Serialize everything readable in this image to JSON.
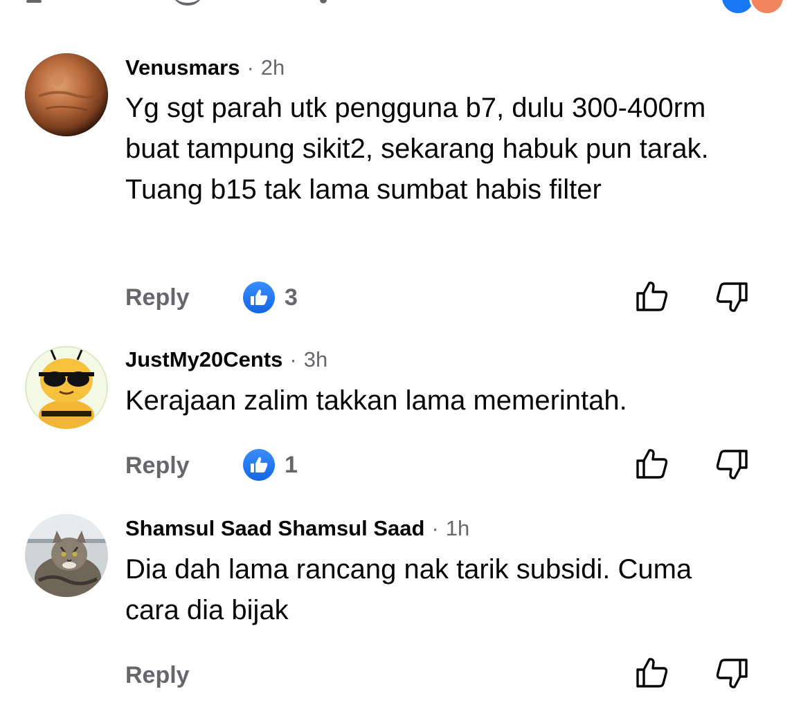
{
  "colors": {
    "primary_text": "#050505",
    "secondary_text": "#65676b",
    "like_blue": "#1877f2",
    "background": "#ffffff"
  },
  "icons": {
    "like_badge": "thumbs-up-icon",
    "upvote": "thumbs-up-outline-icon",
    "downvote": "thumbs-down-outline-icon"
  },
  "comments": [
    {
      "author": "Venusmars",
      "separator": "·",
      "time": "2h",
      "text": "Yg sgt parah utk pengguna b7, dulu 300-400rm buat tampung sikit2, sekarang habuk pun tarak. Tuang b15 tak lama sumbat habis filter",
      "reply_label": "Reply",
      "like_count": "3",
      "avatar": "mars-planet"
    },
    {
      "author": "JustMy20Cents",
      "separator": "·",
      "time": "3h",
      "text": "Kerajaan zalim takkan lama memerintah.",
      "reply_label": "Reply",
      "like_count": "1",
      "avatar": "bee-with-sunglasses"
    },
    {
      "author": "Shamsul Saad Shamsul Saad",
      "separator": "·",
      "time": "1h",
      "text": "Dia dah lama rancang nak tarik subsidi. Cuma cara dia bijak",
      "reply_label": "Reply",
      "avatar": "tabby-cat"
    }
  ]
}
